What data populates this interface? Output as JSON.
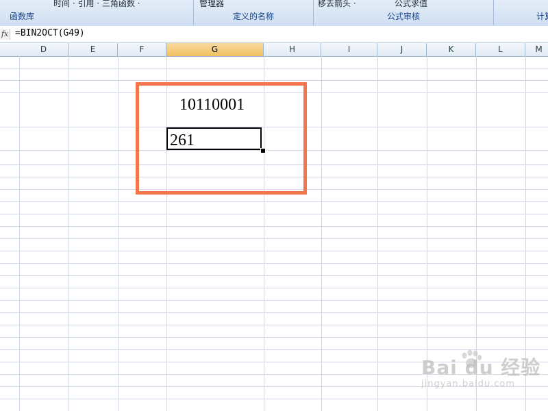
{
  "ribbon": {
    "groups": [
      {
        "name": "function-library",
        "label": "函数库",
        "top": "时间 · 引用 · 三角函数 ·"
      },
      {
        "name": "defined-names",
        "label": "定义的名称",
        "top": "管理器"
      },
      {
        "name": "formula-auditing",
        "label": "公式审核",
        "top_left": "移去箭头 ·",
        "top_right": "公式求值"
      },
      {
        "name": "calculation",
        "label": "计算",
        "top": ""
      }
    ]
  },
  "formula_bar": {
    "fx_label": "fx",
    "formula": "=BIN2OCT(G49)"
  },
  "columns": [
    "D",
    "E",
    "F",
    "G",
    "H",
    "I",
    "J",
    "K",
    "L",
    "M"
  ],
  "active_column": "G",
  "cells": {
    "g49": "10110001",
    "g50": "261"
  },
  "watermark": {
    "main": "Bai du 经验",
    "sub": "jingyan.baidu.com"
  },
  "colors": {
    "highlight_box": "#f4754a",
    "active_column_header": "#f1c15f",
    "ribbon_text": "#15428b",
    "gridline": "#d0d7e5"
  }
}
